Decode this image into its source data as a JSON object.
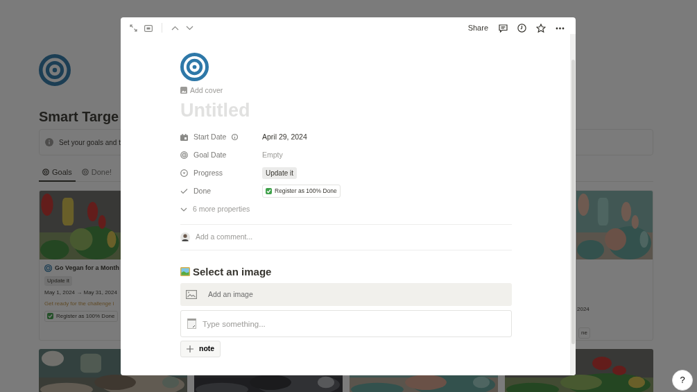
{
  "background_page": {
    "title": "Smart Targe",
    "callout": "Set your goals and t",
    "tabs": [
      {
        "label": "Goals",
        "selected": true
      },
      {
        "label": "Done!",
        "selected": false
      }
    ],
    "cards": [
      {
        "kind": "full",
        "title": "Go Vegan for a Month",
        "progress": "Update it",
        "dates": "May 1, 2024 → May 31, 2024",
        "note": "Get ready for the challenge i",
        "done_tag": "Register as 100% Done"
      },
      {
        "kind": "partial",
        "dates": "2024",
        "done_tag": "ne"
      }
    ],
    "help_button": "?"
  },
  "modal": {
    "share": "Share",
    "add_cover": "Add cover",
    "title_placeholder": "Untitled",
    "properties": [
      {
        "kind": "date",
        "label": "Start Date",
        "info": true,
        "value": "April 29, 2024",
        "empty": false
      },
      {
        "kind": "goal",
        "label": "Goal Date",
        "info": false,
        "value": "Empty",
        "empty": true
      },
      {
        "kind": "progress",
        "label": "Progress",
        "info": false,
        "value": "Update it",
        "empty": false
      },
      {
        "kind": "done",
        "label": "Done",
        "info": false,
        "value": "Register as 100% Done",
        "empty": false
      }
    ],
    "more_properties": "6 more properties",
    "comment_placeholder": "Add a comment...",
    "heading": "Select an image",
    "image_block": "Add an image",
    "note_placeholder": "Type something...",
    "note_button": "note"
  }
}
